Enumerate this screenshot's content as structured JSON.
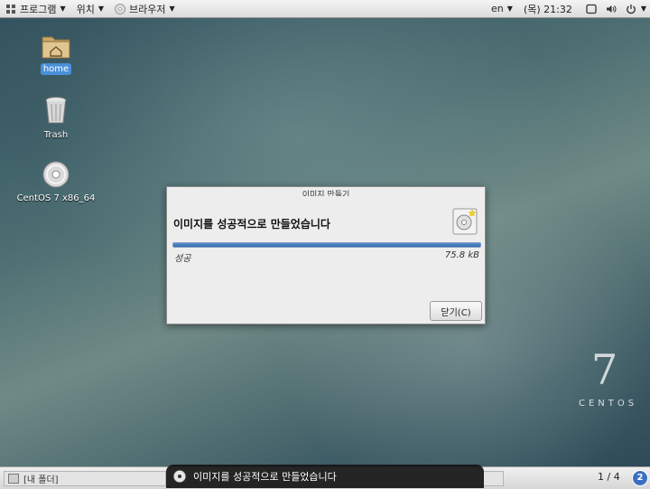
{
  "topbar": {
    "applications": "프로그램",
    "places": "위치",
    "browser": "브라우저",
    "language": "en",
    "clock": "(목) 21:32"
  },
  "desktop": {
    "icons": [
      {
        "label": "home",
        "icon": "home-folder-icon"
      },
      {
        "label": "Trash",
        "icon": "trash-icon"
      },
      {
        "label": "CentOS 7 x86_64",
        "icon": "disc-icon"
      }
    ],
    "branding": {
      "number": "7",
      "word": "CENTOS"
    }
  },
  "dialog": {
    "title": "이미지 만들기",
    "heading": "이미지를 성공적으로 만들었습니다",
    "progress": 1.0,
    "status": "성공",
    "size": "75.8 kB",
    "close_label": "닫기(C)"
  },
  "bottombar": {
    "task_label": "[내 폴더]",
    "workspace": "1 / 4",
    "notification_count": "2"
  },
  "notification": {
    "text": "이미지를 성공적으로 만들었습니다"
  },
  "colors": {
    "accent": "#4a90d9",
    "progress": "#3469b0"
  }
}
